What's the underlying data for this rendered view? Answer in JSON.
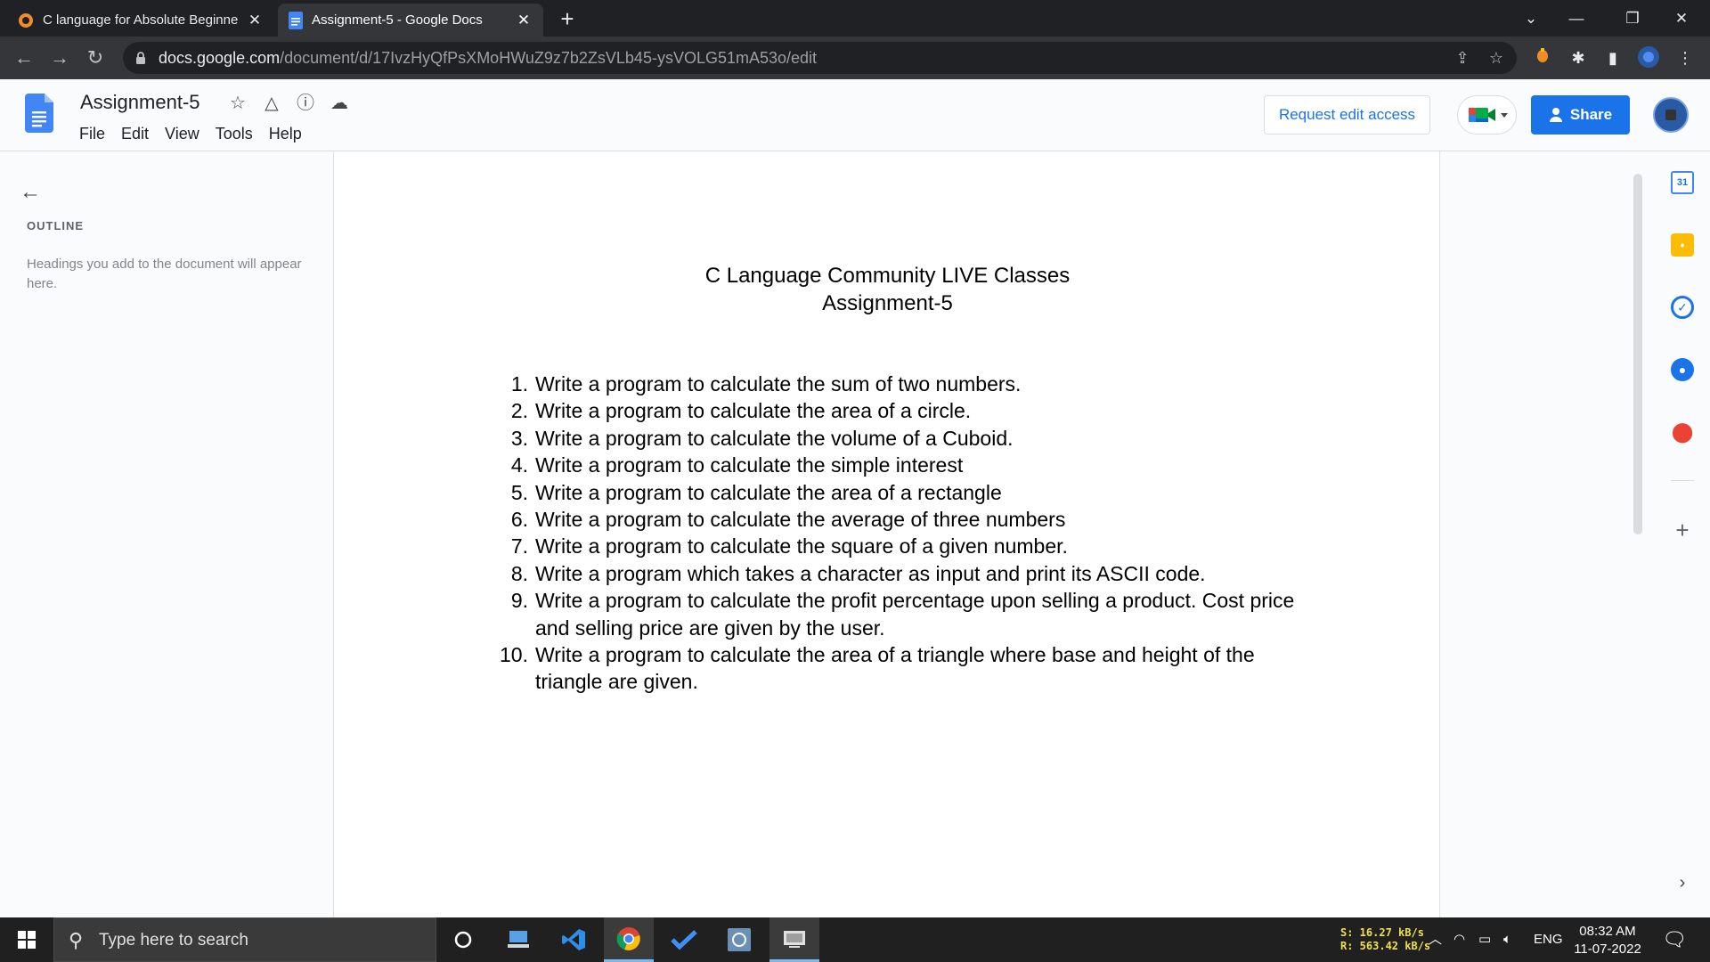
{
  "browser": {
    "tabs": [
      {
        "title": "C language for Absolute Beginne",
        "active": false
      },
      {
        "title": "Assignment-5 - Google Docs",
        "active": true
      }
    ],
    "url_host": "docs.google.com",
    "url_path": "/document/d/17IvzHyQfPsXMoHWuZ9z7b2ZsVLb45-ysVOLG51mA53o/edit"
  },
  "docs": {
    "title": "Assignment-5",
    "menu": [
      "File",
      "Edit",
      "View",
      "Tools",
      "Help"
    ],
    "request_edit_label": "Request edit access",
    "share_label": "Share",
    "brand_color": "#1a73e8"
  },
  "outline": {
    "title": "OUTLINE",
    "hint": "Headings you add to the document will appear here."
  },
  "document": {
    "heading_line1": "C Language Community LIVE Classes",
    "heading_line2": "Assignment-5",
    "items": [
      {
        "num": "1.",
        "text": "Write  a program to calculate the sum of two numbers."
      },
      {
        "num": "2.",
        "text": "Write a program to calculate the area of a circle."
      },
      {
        "num": "3.",
        "text": "Write a program to calculate the volume of a Cuboid."
      },
      {
        "num": "4.",
        "text": "Write a program to calculate the simple interest"
      },
      {
        "num": "5.",
        "text": "Write a program to calculate the area of a rectangle"
      },
      {
        "num": "6.",
        "text": "Write a program to calculate the average of three numbers"
      },
      {
        "num": "7.",
        "text": "Write a program to calculate the square of a given number."
      },
      {
        "num": "8.",
        "text": "Write a program which takes a character as input and print its ASCII code."
      },
      {
        "num": "9.",
        "text": "Write a program to calculate the profit percentage upon selling a product. Cost price and selling price are given by the user."
      },
      {
        "num": "10.",
        "text": "Write a program to calculate the area of a triangle where base and height of the triangle are given."
      }
    ]
  },
  "side_panel": {
    "calendar_day": "31"
  },
  "taskbar": {
    "search_placeholder": "Type here to search",
    "net_send": "S:  16.27 kB/s",
    "net_recv": "R: 563.42 kB/s",
    "language": "ENG",
    "time": "08:32 AM",
    "date": "11-07-2022"
  }
}
